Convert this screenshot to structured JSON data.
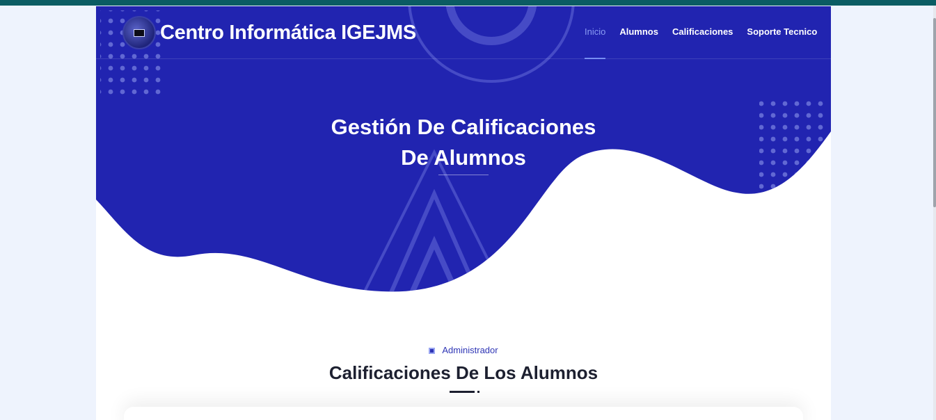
{
  "brand": {
    "title": "Centro Informática IGEJMS",
    "logo_icon": "school-logo-icon"
  },
  "nav": {
    "items": [
      {
        "label": "Inicio",
        "active": true
      },
      {
        "label": "Alumnos",
        "active": false
      },
      {
        "label": "Calificaciones",
        "active": false
      },
      {
        "label": "Soporte Tecnico",
        "active": false
      }
    ]
  },
  "hero": {
    "title_line1": "Gestión De Calificaciones",
    "title_line2": "De Alumnos"
  },
  "section": {
    "tag": "Administrador",
    "title": "Calificaciones De Los Alumnos"
  },
  "colors": {
    "top_bar": "#0b5c63",
    "hero_background": "#2124b0",
    "active_nav": "#8a9cf4",
    "accent_text": "#2e35b5",
    "page_background": "#eef3fd"
  }
}
